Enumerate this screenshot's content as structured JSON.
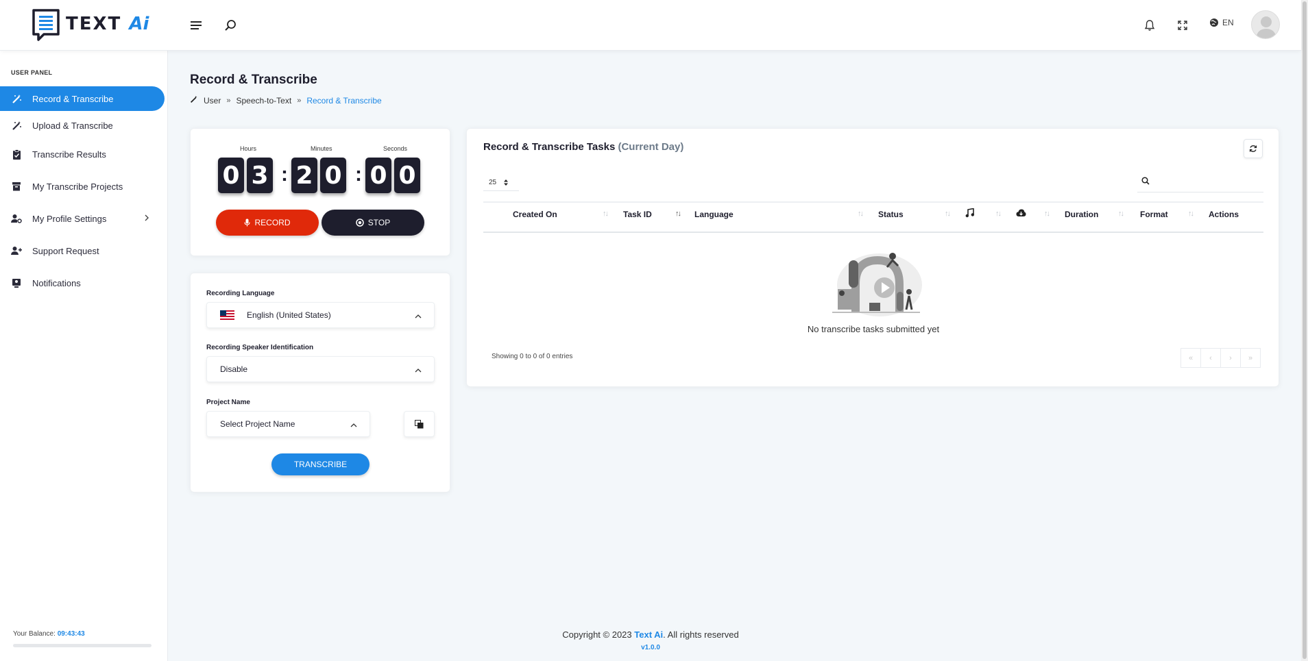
{
  "brand": {
    "name": "TEXT",
    "suffix": "Ai"
  },
  "header": {
    "lang": "EN"
  },
  "sidebar": {
    "heading": "USER PANEL",
    "items": [
      {
        "label": "Record & Transcribe"
      },
      {
        "label": "Upload & Transcribe"
      },
      {
        "label": "Transcribe Results"
      },
      {
        "label": "My Transcribe Projects"
      },
      {
        "label": "My Profile Settings"
      },
      {
        "label": "Support Request"
      },
      {
        "label": "Notifications"
      }
    ],
    "balance_label": "Your Balance:",
    "balance_value": "09:43:43"
  },
  "page": {
    "title": "Record & Transcribe",
    "breadcrumb": [
      "User",
      "Speech-to-Text",
      "Record & Transcribe"
    ]
  },
  "timer": {
    "labels": {
      "hours": "Hours",
      "minutes": "Minutes",
      "seconds": "Seconds"
    },
    "digits": [
      "0",
      "3",
      "2",
      "0",
      "0",
      "0"
    ],
    "record_label": "RECORD",
    "stop_label": "STOP"
  },
  "form": {
    "language_label": "Recording Language",
    "language_value": "English (United States)",
    "speaker_label": "Recording Speaker Identification",
    "speaker_value": "Disable",
    "project_label": "Project Name",
    "project_value": "Select Project Name",
    "transcribe_label": "TRANSCRIBE"
  },
  "table": {
    "title": "Record & Transcribe Tasks",
    "title_sub": "(Current Day)",
    "page_size": "25",
    "columns": {
      "created": "Created On",
      "task_id": "Task ID",
      "language": "Language",
      "status": "Status",
      "duration": "Duration",
      "format": "Format",
      "actions": "Actions"
    },
    "empty": "No transcribe tasks submitted yet",
    "showing": "Showing 0 to 0 of 0 entries"
  },
  "footer": {
    "copyright_prefix": "Copyright © 2023",
    "brand": "Text Ai",
    "suffix": ". All rights reserved",
    "version": "v1.0.0"
  },
  "colors": {
    "accent": "#1e88e5",
    "record": "#e0290a",
    "dark": "#1e1e2d"
  }
}
